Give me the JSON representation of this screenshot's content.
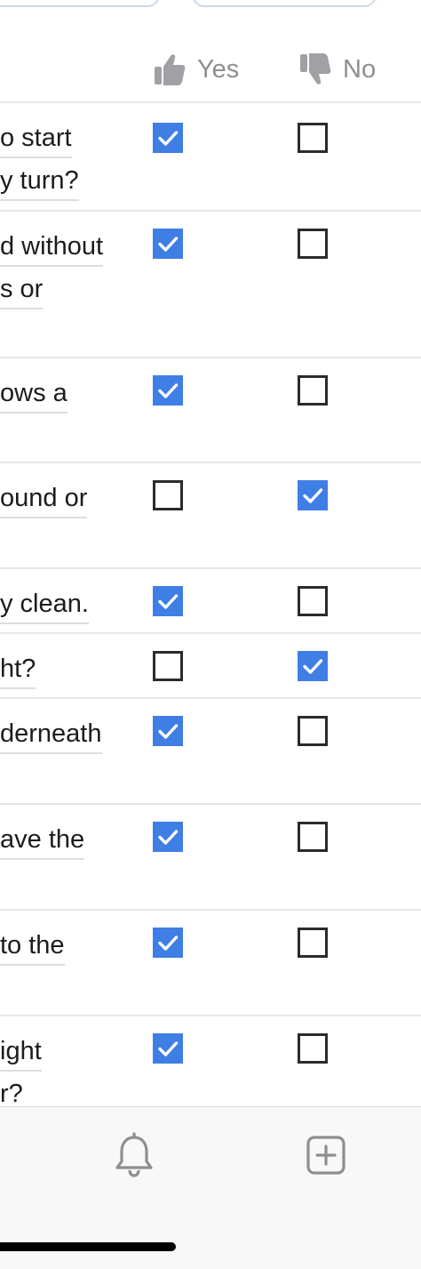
{
  "header": {
    "yes_label": "Yes",
    "no_label": "No",
    "yes_icon": "thumbs-up-icon",
    "no_icon": "thumbs-down-icon"
  },
  "questions": [
    {
      "lines": [
        "o start",
        "y turn?"
      ],
      "yes": true,
      "no": false
    },
    {
      "lines": [
        "d without",
        "s or"
      ],
      "yes": true,
      "no": false
    },
    {
      "lines": [
        "ows a"
      ],
      "yes": true,
      "no": false
    },
    {
      "lines": [
        "ound or"
      ],
      "yes": false,
      "no": true
    },
    {
      "lines": [
        "y clean."
      ],
      "yes": true,
      "no": false
    },
    {
      "lines": [
        "ht?"
      ],
      "yes": false,
      "no": true
    },
    {
      "lines": [
        "derneath"
      ],
      "yes": true,
      "no": false
    },
    {
      "lines": [
        "ave the"
      ],
      "yes": true,
      "no": false
    },
    {
      "lines": [
        "to the"
      ],
      "yes": true,
      "no": false
    },
    {
      "lines": [
        "ight",
        "r?"
      ],
      "yes": true,
      "no": false
    }
  ],
  "tabbar": {
    "items": [
      {
        "icon": "bell-icon"
      },
      {
        "icon": "add-square-icon"
      }
    ]
  },
  "colors": {
    "checked": "#3f7ee4",
    "header_text": "#8e8e93",
    "divider": "#e6e6e6"
  }
}
